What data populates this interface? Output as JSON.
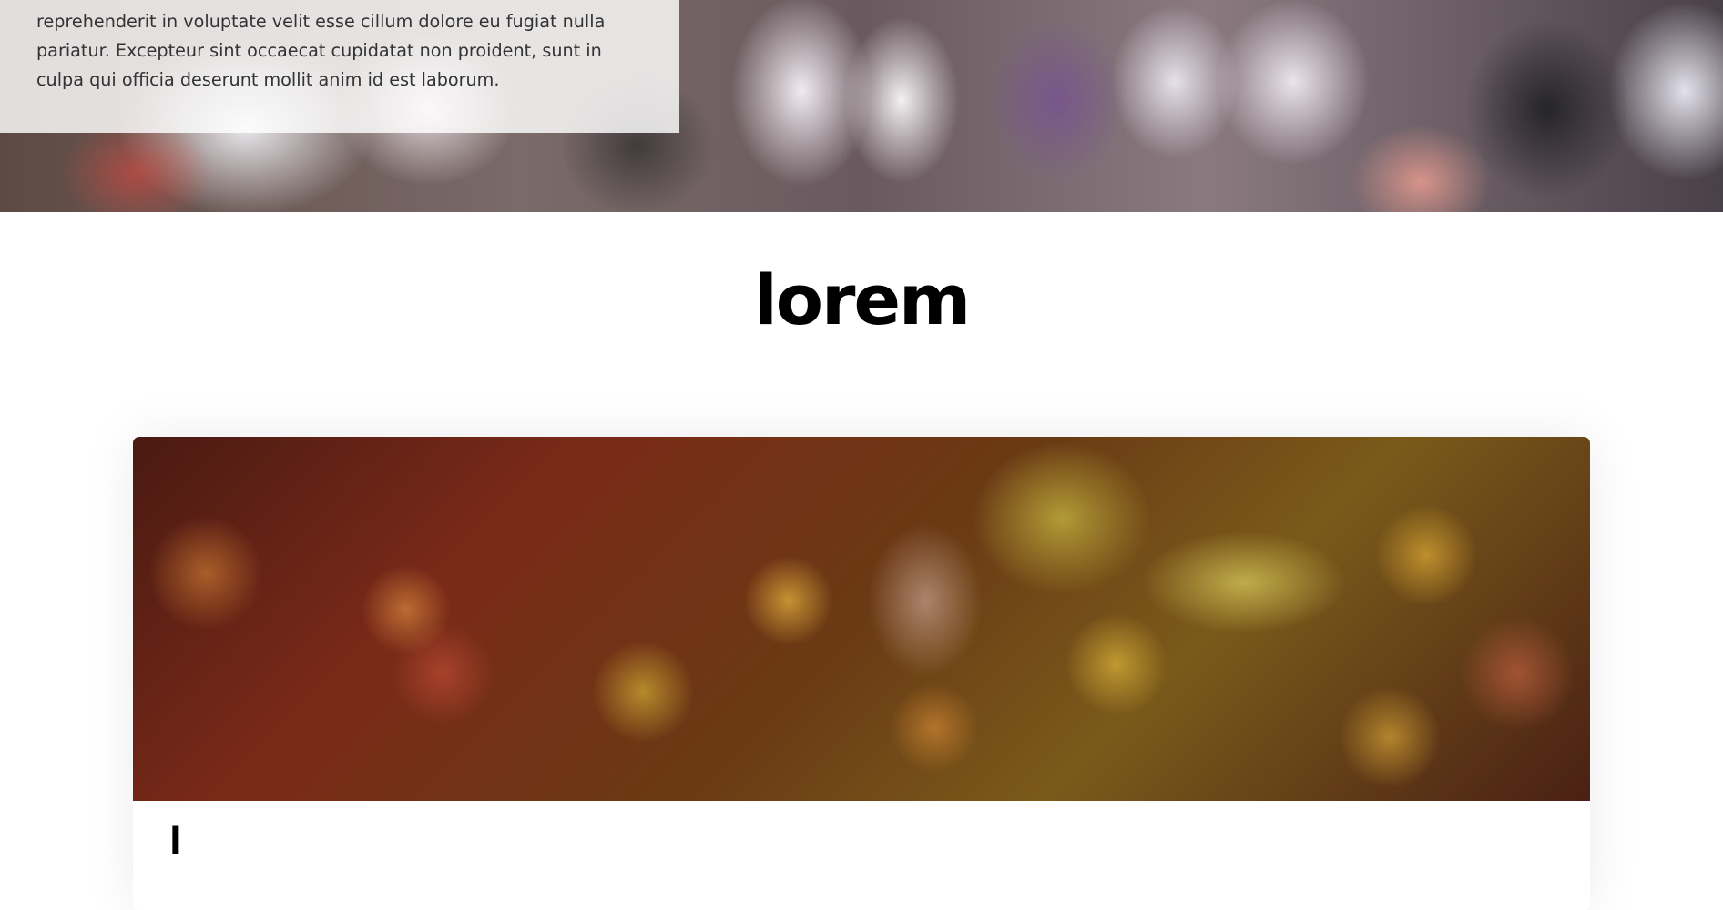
{
  "hero": {
    "text": "reprehenderit in voluptate velit esse cillum dolore eu fugiat nulla pariatur. Excepteur sint occaecat cupidatat non proident, sunt in culpa qui officia deserunt mollit anim id est laborum."
  },
  "section": {
    "title": "lorem"
  },
  "card": {
    "heading": "l"
  }
}
